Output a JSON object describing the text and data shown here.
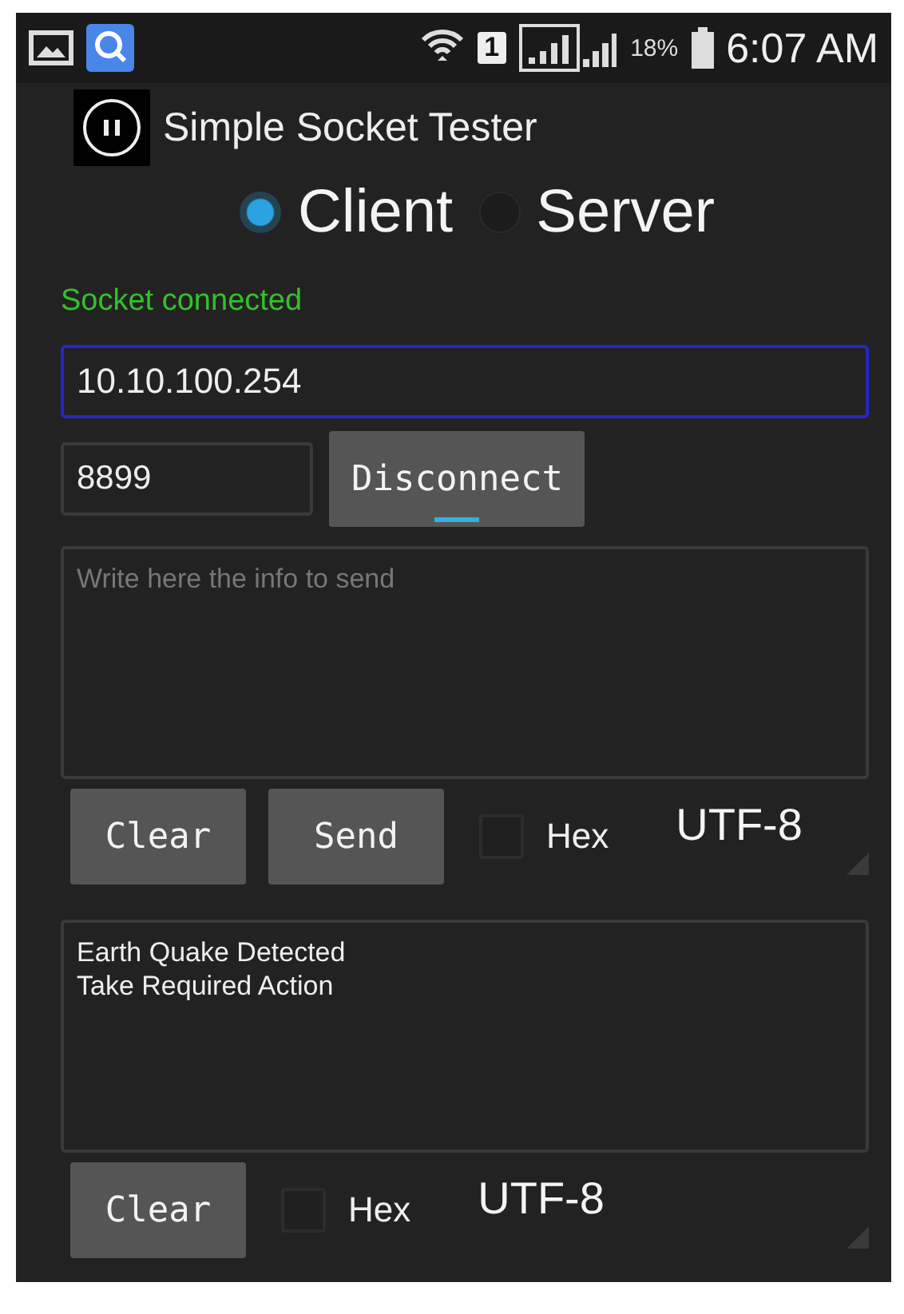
{
  "status_bar": {
    "sim_slot": "1",
    "battery": "18%",
    "time": "6:07 AM"
  },
  "app_bar": {
    "title": "Simple Socket Tester"
  },
  "mode": [
    {
      "label": "Client",
      "selected": true
    },
    {
      "label": "Server",
      "selected": false
    }
  ],
  "status_message": "Socket connected",
  "host_field": {
    "value": "10.10.100.254",
    "focused": true
  },
  "port_field": {
    "value": "8899"
  },
  "connect_button": {
    "label": "Disconnect"
  },
  "send_box": {
    "placeholder": "Write here the info to send"
  },
  "send_controls": {
    "clear_button": "Clear",
    "send_button": "Send",
    "hex": {
      "label": "Hex",
      "checked": false
    },
    "encoding": "UTF-8"
  },
  "receive_box": {
    "value": "Earth Quake Detected\nTake Required Action"
  },
  "receive_controls": {
    "clear_button": "Clear",
    "hex": {
      "label": "Hex",
      "checked": false
    },
    "encoding": "UTF-8"
  }
}
